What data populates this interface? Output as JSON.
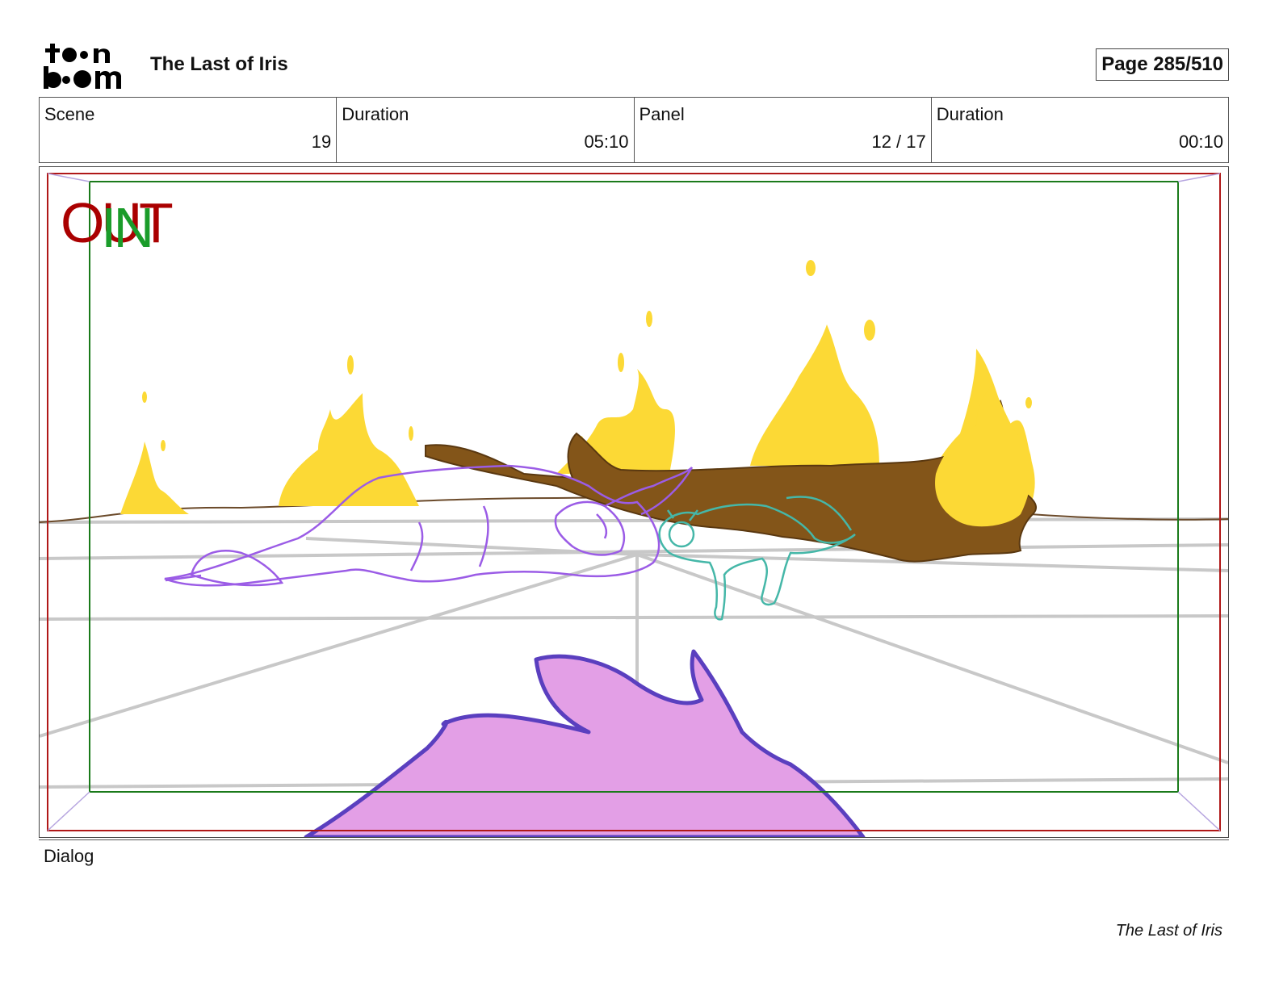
{
  "header": {
    "logo_text": "toon boom",
    "title": "The Last of Iris",
    "page_label": "Page 285/510"
  },
  "info": {
    "scene_label": "Scene",
    "scene_value": "19",
    "scene_duration_label": "Duration",
    "scene_duration_value": "05:10",
    "panel_label": "Panel",
    "panel_value": "12 / 17",
    "panel_duration_label": "Duration",
    "panel_duration_value": "00:10"
  },
  "panel": {
    "cut_out": "OUT",
    "cut_in": "IN",
    "colors": {
      "frame_red": "#b01818",
      "frame_green": "#1a7a1a",
      "fire": "#fcd935",
      "log": "#835519",
      "creature_purple": "#9b5ce6",
      "creature_teal": "#45b7a8",
      "foreground_pink": "#e39fe6",
      "foreground_outline": "#5a3fbf"
    }
  },
  "dialog": {
    "label": "Dialog"
  },
  "footer": {
    "text": "The Last of Iris"
  }
}
